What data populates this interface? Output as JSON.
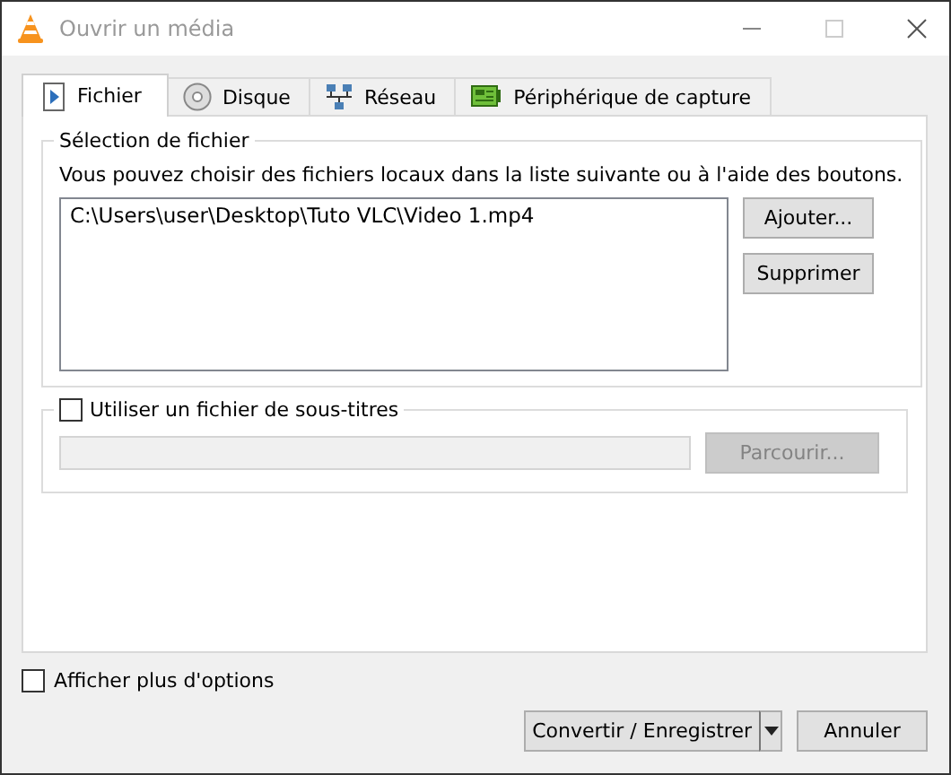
{
  "window": {
    "title": "Ouvrir un média"
  },
  "tabs": [
    {
      "label": "Fichier",
      "kind": "file",
      "selected": true
    },
    {
      "label": "Disque",
      "kind": "disc",
      "selected": false
    },
    {
      "label": "Réseau",
      "kind": "network",
      "selected": false
    },
    {
      "label": "Périphérique de capture",
      "kind": "capture",
      "selected": false
    }
  ],
  "file_selection": {
    "title": "Sélection de fichier",
    "hint": "Vous pouvez choisir des fichiers locaux dans la liste suivante ou à l'aide des boutons.",
    "files": [
      "C:\\Users\\user\\Desktop\\Tuto VLC\\Video 1.mp4"
    ],
    "buttons": [
      {
        "label": "Ajouter...",
        "disabled": false
      },
      {
        "label": "Supprimer",
        "disabled": false
      }
    ]
  },
  "subtitles": {
    "label": "Utiliser un fichier de sous-titres",
    "checked": false,
    "browse": {
      "label": "Parcourir...",
      "disabled": true
    }
  },
  "more_options": {
    "label": "Afficher plus d'options",
    "checked": false
  },
  "buttons": [
    {
      "label": "Convertir / Enregistrer",
      "kind": "split"
    },
    {
      "label": "Annuler",
      "kind": "plain"
    }
  ]
}
